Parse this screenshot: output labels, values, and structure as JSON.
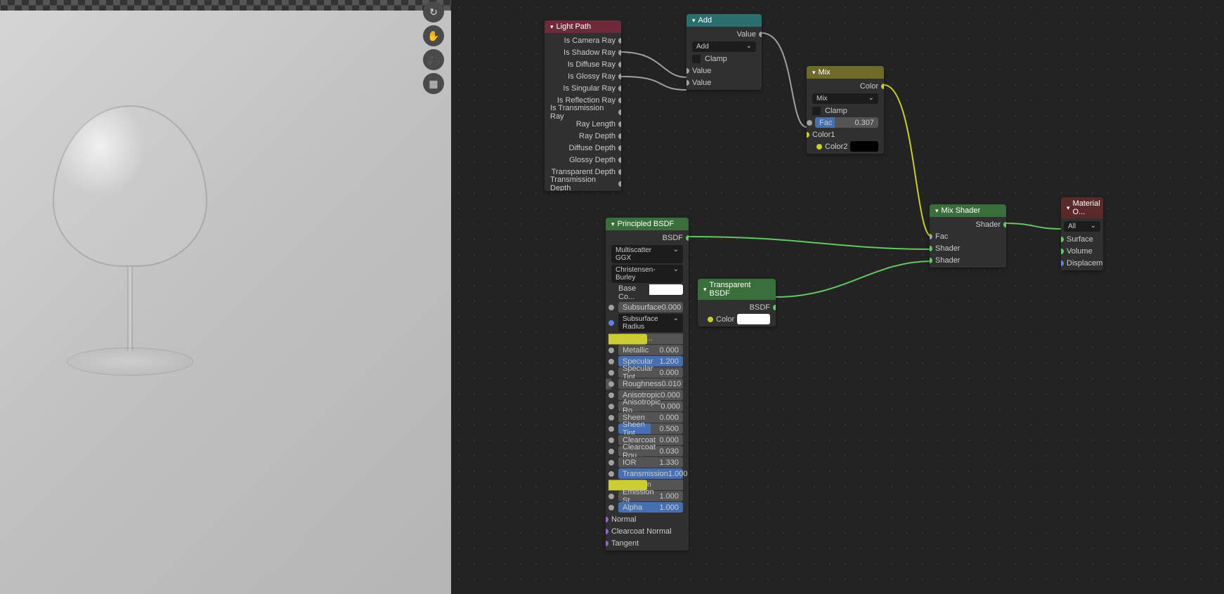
{
  "viewport_tools": [
    "↻",
    "✋",
    "🎥",
    "▦"
  ],
  "nodes": {
    "lightpath": {
      "title": "Light Path",
      "outputs": [
        "Is Camera Ray",
        "Is Shadow Ray",
        "Is Diffuse Ray",
        "Is Glossy Ray",
        "Is Singular Ray",
        "Is Reflection Ray",
        "Is Transmission Ray",
        "Ray Length",
        "Ray Depth",
        "Diffuse Depth",
        "Glossy Depth",
        "Transparent Depth",
        "Transmission Depth"
      ]
    },
    "add": {
      "title": "Add",
      "out": "Value",
      "op": "Add",
      "clamp": "Clamp",
      "in1": "Value",
      "in2": "Value"
    },
    "mix": {
      "title": "Mix",
      "out": "Color",
      "type": "Mix",
      "clamp": "Clamp",
      "fac": {
        "label": "Fac",
        "value": "0.307"
      },
      "c1": "Color1",
      "c2": "Color2"
    },
    "principled": {
      "title": "Principled BSDF",
      "out": "BSDF",
      "dist": "Multiscatter GGX",
      "sss": "Christensen-Burley",
      "base_label": "Base Co...",
      "subr": "Subsurface Radius",
      "subc": "Subsurf...",
      "emission": "Emission",
      "params": [
        {
          "label": "Subsurface",
          "value": "0.000",
          "blue": false
        },
        {
          "label": "Metallic",
          "value": "0.000",
          "blue": false
        },
        {
          "label": "Specular",
          "value": "1.200",
          "blue": true,
          "p": "100%"
        },
        {
          "label": "Specular Tint",
          "value": "0.000",
          "blue": false
        },
        {
          "label": "Roughness",
          "value": "0.010",
          "blue": false
        },
        {
          "label": "Anisotropic",
          "value": "0.000",
          "blue": false
        },
        {
          "label": "Anisotropic Ro...",
          "value": "0.000",
          "blue": false
        },
        {
          "label": "Sheen",
          "value": "0.000",
          "blue": false
        },
        {
          "label": "Sheen Tint",
          "value": "0.500",
          "blue": true,
          "p": "50%"
        },
        {
          "label": "Clearcoat",
          "value": "0.000",
          "blue": false
        },
        {
          "label": "Clearcoat Rou...",
          "value": "0.030",
          "blue": false
        },
        {
          "label": "IOR",
          "value": "1.330",
          "blue": false
        },
        {
          "label": "Transmission",
          "value": "1.000",
          "blue": true,
          "p": "100%"
        },
        {
          "label": "Emission St...",
          "value": "1.000",
          "blue": false
        },
        {
          "label": "Alpha",
          "value": "1.000",
          "blue": true,
          "p": "100%"
        }
      ],
      "vec": [
        "Normal",
        "Clearcoat Normal",
        "Tangent"
      ]
    },
    "transparent": {
      "title": "Transparent BSDF",
      "out": "BSDF",
      "color": "Color"
    },
    "mixshader": {
      "title": "Mix Shader",
      "out": "Shader",
      "fac": "Fac",
      "s1": "Shader",
      "s2": "Shader"
    },
    "output": {
      "title": "Material O...",
      "target": "All",
      "surf": "Surface",
      "vol": "Volume",
      "disp": "Displacement"
    }
  }
}
